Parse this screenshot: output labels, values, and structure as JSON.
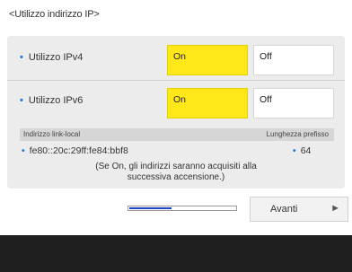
{
  "title": "<Utilizzo indirizzo IP>",
  "ipv4": {
    "label": "Utilizzo IPv4",
    "on_label": "On",
    "off_label": "Off",
    "selected": "On"
  },
  "ipv6": {
    "label": "Utilizzo IPv6",
    "on_label": "On",
    "off_label": "Off",
    "selected": "On"
  },
  "linklocal": {
    "col_address": "Indirizzo link-local",
    "col_prefix": "Lunghezza prefisso",
    "address": "fe80::20c:29ff:fe84:bbf8",
    "prefix": "64"
  },
  "note_line1": "(Se On, gli indirizzi saranno acquisiti alla",
  "note_line2": "successiva accensione.)",
  "progress": {
    "fraction": 0.4
  },
  "next_label": "Avanti",
  "colors": {
    "accent": "#ffe81a",
    "progress": "#1a47c9",
    "bullet": "#2d6fd6"
  }
}
